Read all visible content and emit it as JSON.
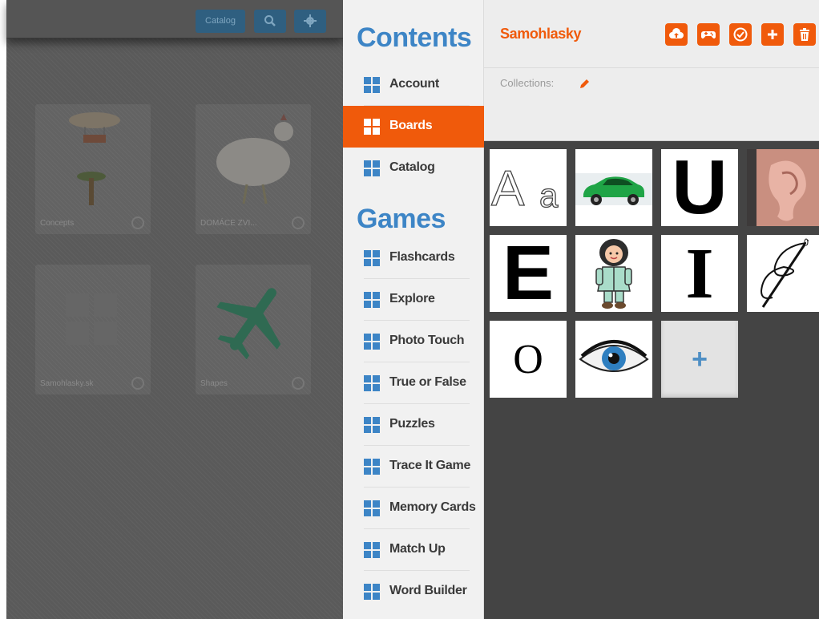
{
  "background": {
    "topbar": {
      "catalog_label": "Catalog",
      "search_icon": "search-icon",
      "gear_icon": "gear-icon"
    },
    "tiles": [
      {
        "label": "Concepts"
      },
      {
        "label": "DOMÁCE ZVI..."
      },
      {
        "label": "Samohlasky.sk"
      },
      {
        "label": "Shapes"
      }
    ]
  },
  "sidebar": {
    "contents_heading": "Contents",
    "contents_items": [
      {
        "label": "Account"
      },
      {
        "label": "Boards",
        "active": true
      },
      {
        "label": "Catalog"
      }
    ],
    "games_heading": "Games",
    "games_items": [
      {
        "label": "Flashcards"
      },
      {
        "label": "Explore"
      },
      {
        "label": "Photo Touch"
      },
      {
        "label": "True or False"
      },
      {
        "label": "Puzzles"
      },
      {
        "label": "Trace It Game"
      },
      {
        "label": "Memory Cards"
      },
      {
        "label": "Match Up"
      },
      {
        "label": "Word Builder"
      }
    ]
  },
  "board": {
    "title": "Samohlasky",
    "collections_label": "Collections:",
    "toolbar_icons": [
      "upload-icon",
      "gamepad-icon",
      "check-icon",
      "add-icon",
      "trash-icon"
    ],
    "cards": [
      {
        "kind": "outline-letters",
        "text_upper": "A",
        "text_lower": "a"
      },
      {
        "kind": "image",
        "icon": "green-car-icon"
      },
      {
        "kind": "letter",
        "text": "U"
      },
      {
        "kind": "image",
        "icon": "ear-icon"
      },
      {
        "kind": "letter",
        "text": "E"
      },
      {
        "kind": "image",
        "icon": "eskimo-icon"
      },
      {
        "kind": "letter",
        "text": "I"
      },
      {
        "kind": "image",
        "icon": "needle-icon"
      },
      {
        "kind": "letter",
        "text": "O"
      },
      {
        "kind": "image",
        "icon": "eye-icon"
      },
      {
        "kind": "add",
        "text": "+"
      }
    ]
  },
  "colors": {
    "accent_orange": "#f05a0b",
    "accent_blue": "#3d85c6",
    "dark_panel": "#444444"
  }
}
